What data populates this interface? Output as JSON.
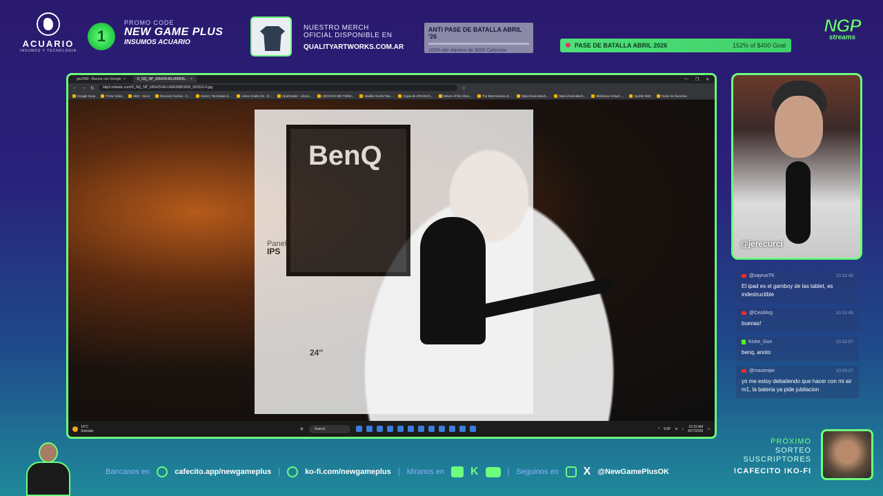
{
  "sponsor": {
    "name": "ACUARIO",
    "subtitle": "INSUMOS Y TECNOLOGIA"
  },
  "promo": {
    "coin_glyph": "1",
    "label": "PROMO CODE",
    "code": "NEW GAME PLUS",
    "sub": "INSUMOS ACUARIO"
  },
  "merch": {
    "line1": "NUESTRO MERCH",
    "line2": "OFICIAL DISPONIBLE EN",
    "url": "QUALITYARTWORKS.COM.AR"
  },
  "anti_goal": {
    "title": "ANTI PASE DE BATALLA ABRIL '26",
    "progress": "100% del objetivo de 3000 Cafecitos",
    "fraction": 1.0
  },
  "battle_pass": {
    "title": "PASE DE BATALLA ABRIL 2026",
    "amount": "152% of $400 Goal"
  },
  "brand": {
    "logo": "NGP",
    "sub": "streams"
  },
  "browser": {
    "tabs": [
      {
        "label": "gw2480 - Buscar con Google",
        "active": false
      },
      {
        "label": "D_NQ_NP_695429-MLU69636...",
        "active": true
      }
    ],
    "address": "http2.mlstatic.com/D_NQ_NP_695429-MLU69636853900_052023-F.jpg",
    "bookmarks": [
      "Google Keep",
      "Prime Video",
      "HBO - Inicio",
      "Discover Games - K...",
      "Home | Terminado b...",
      "Libros Gratis XD - D...",
      "EpubGratis - Libros...",
      "ARCHIVO MN TWEE...",
      "Maldito Nerds Twe...",
      "Copia de ARCHIVO...",
      "Return of the Obra...",
      "The Best Movies of...",
      "https://mail-attach...",
      "https://mail-attach...",
      "Biblioteca Virtual -...",
      "Spotify Web",
      "Todos los favoritos"
    ]
  },
  "image": {
    "brand": "BenQ",
    "panel_label": "Panel",
    "panel_type": "IPS",
    "size": "24''"
  },
  "taskbar": {
    "temp": "10°C",
    "weather": "Soleado",
    "search": "Search",
    "lang": "ESP",
    "time": "10:33 AM",
    "date": "4/27/2026"
  },
  "cam": {
    "handle": "@jerecurci"
  },
  "chat": [
    {
      "user": "@zayrusTK",
      "time": "10:31:45",
      "text": "El ipad es el gamboy de las tablet, es indestructible",
      "platform": "youtube"
    },
    {
      "user": "@CesitArg",
      "time": "10:31:45",
      "text": "buenas!",
      "platform": "youtube"
    },
    {
      "user": "Kicke_Gun",
      "time": "10:32:57",
      "text": "benq, anoto",
      "platform": "kick"
    },
    {
      "user": "@maximipe",
      "time": "10:33:27",
      "text": "yo me estoy debatiendo que hacer con mi air m1, la bateria ya pide jubilacion",
      "platform": "youtube"
    }
  ],
  "footer": {
    "bancanos": "Bancanos en",
    "cafecito": "cafecito.app/newgameplus",
    "kofi": "ko-fi.com/newgameplus",
    "miranos": "Miranos en",
    "seguinos": "Seguinos en",
    "handle": "@NewGamePlusOK",
    "sep": "|",
    "kick_glyph": "K",
    "x_glyph": "X"
  },
  "sorteo": {
    "l1": "PRÓXIMO",
    "l2": "SORTEO",
    "l3": "SUSCRIPTORES",
    "cmd": "!CAFECITO !KO-FI"
  },
  "colors": {
    "accent": "#6dff7d",
    "bg_top": "#2a1a6e",
    "bg_bottom": "#1f8a9a"
  }
}
